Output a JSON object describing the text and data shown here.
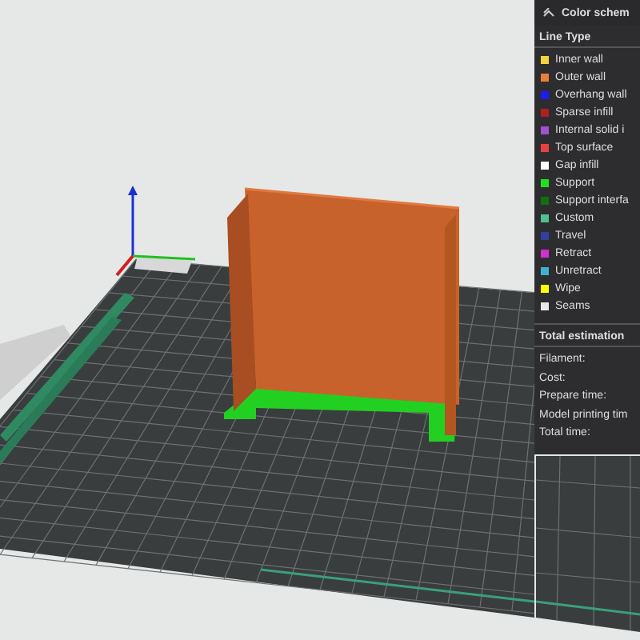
{
  "legend": {
    "title": "Color schem",
    "section_title": "Line Type",
    "line_types": [
      {
        "label": "Inner wall",
        "color": "#f5d33a"
      },
      {
        "label": "Outer wall",
        "color": "#e8803a"
      },
      {
        "label": "Overhang wall",
        "color": "#1c1cf0"
      },
      {
        "label": "Sparse infill",
        "color": "#b02020"
      },
      {
        "label": "Internal solid i",
        "color": "#a050d0"
      },
      {
        "label": "Top surface",
        "color": "#e84040"
      },
      {
        "label": "Gap infill",
        "color": "#ffffff"
      },
      {
        "label": "Support",
        "color": "#20e020"
      },
      {
        "label": "Support interfa",
        "color": "#107010"
      },
      {
        "label": "Custom",
        "color": "#50c090"
      },
      {
        "label": "Travel",
        "color": "#3040a0"
      },
      {
        "label": "Retract",
        "color": "#d030d0"
      },
      {
        "label": "Unretract",
        "color": "#40b0d0"
      },
      {
        "label": "Wipe",
        "color": "#ffff00"
      },
      {
        "label": "Seams",
        "color": "#e8e8e8"
      }
    ]
  },
  "estimation": {
    "title": "Total estimation",
    "rows": [
      "Filament:",
      "Cost:",
      "Prepare time:",
      "Model printing tim",
      "Total time:"
    ]
  }
}
